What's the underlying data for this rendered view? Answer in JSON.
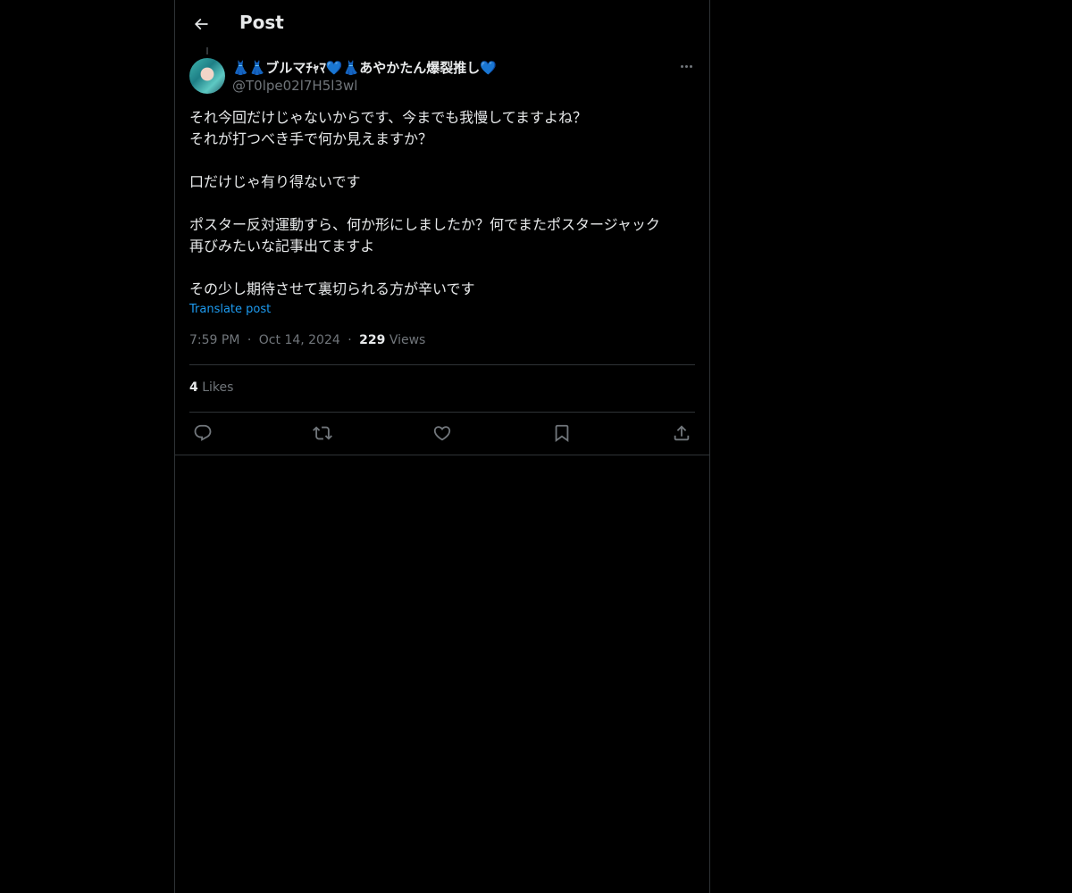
{
  "header": {
    "title": "Post",
    "back_icon": "arrow-left-icon"
  },
  "author": {
    "display_name": "👗👗ブルマﾁｬﾏ💙👗あやかたん爆裂推し💙",
    "handle": "@T0lpe02l7H5l3wl",
    "avatar_icon": "avatar-image"
  },
  "post": {
    "lines": [
      "それ今回だけじゃないからです、今までも我慢してますよね？",
      "それが打つべき手で何か見えますか？",
      "",
      "口だけじゃ有り得ないです",
      "",
      "ポスター反対運動すら、何か形にしましたか？何でまたポスタージャック",
      "再びみたいな記事出てますよ",
      "",
      "その少し期待させて裏切られる方が辛いです"
    ],
    "translate_label": "Translate post",
    "time": "7:59 PM",
    "date": "Oct 14, 2024",
    "separator": "·",
    "views_count": "229",
    "views_label": "Views",
    "likes_count": "4",
    "likes_label": "Likes"
  },
  "actions": [
    "reply-icon",
    "repost-icon",
    "like-icon",
    "bookmark-icon",
    "share-icon"
  ],
  "colors": {
    "background": "#000000",
    "text": "#e7e9ea",
    "muted": "#71767b",
    "link": "#1d9bf0",
    "border": "#2f3336"
  }
}
